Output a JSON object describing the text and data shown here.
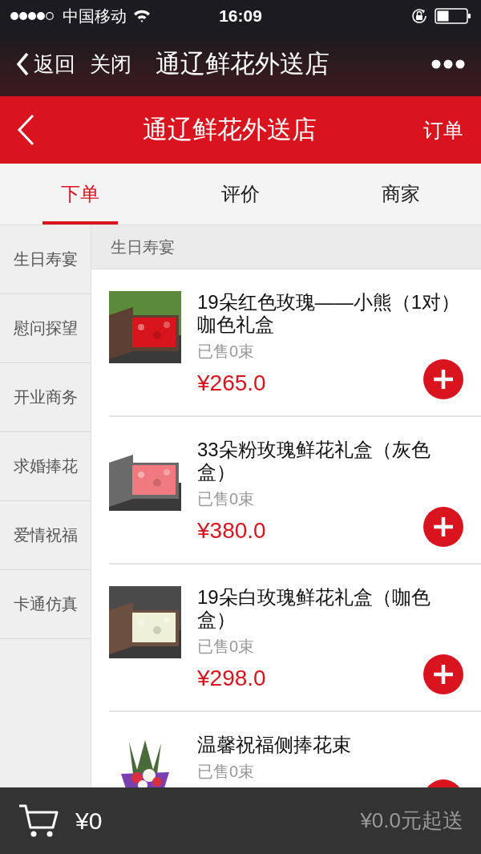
{
  "status_bar": {
    "carrier": "中国移动",
    "time": "16:09"
  },
  "wechat_bar": {
    "back": "返回",
    "close": "关闭",
    "title": "通辽鲜花外送店"
  },
  "header": {
    "title": "通辽鲜花外送店",
    "orders": "订单"
  },
  "tabs": [
    {
      "label": "下单",
      "selected": true
    },
    {
      "label": "评价",
      "selected": false
    },
    {
      "label": "商家",
      "selected": false
    }
  ],
  "categories": [
    "生日寿宴",
    "慰问探望",
    "开业商务",
    "求婚捧花",
    "爱情祝福",
    "卡通仿真"
  ],
  "section_title": "生日寿宴",
  "products": [
    {
      "name": "19朵红色玫瑰——小熊（1对）咖色礼盒",
      "sold": "已售0束",
      "price": "¥265.0"
    },
    {
      "name": "33朵粉玫瑰鲜花礼盒（灰色盒）",
      "sold": "已售0束",
      "price": "¥380.0"
    },
    {
      "name": "19朵白玫瑰鲜花礼盒（咖色盒）",
      "sold": "已售0束",
      "price": "¥298.0"
    },
    {
      "name": "温馨祝福侧捧花束",
      "sold": "已售0束"
    }
  ],
  "cart": {
    "total": "¥0",
    "minimum": "¥0.0元起送"
  }
}
